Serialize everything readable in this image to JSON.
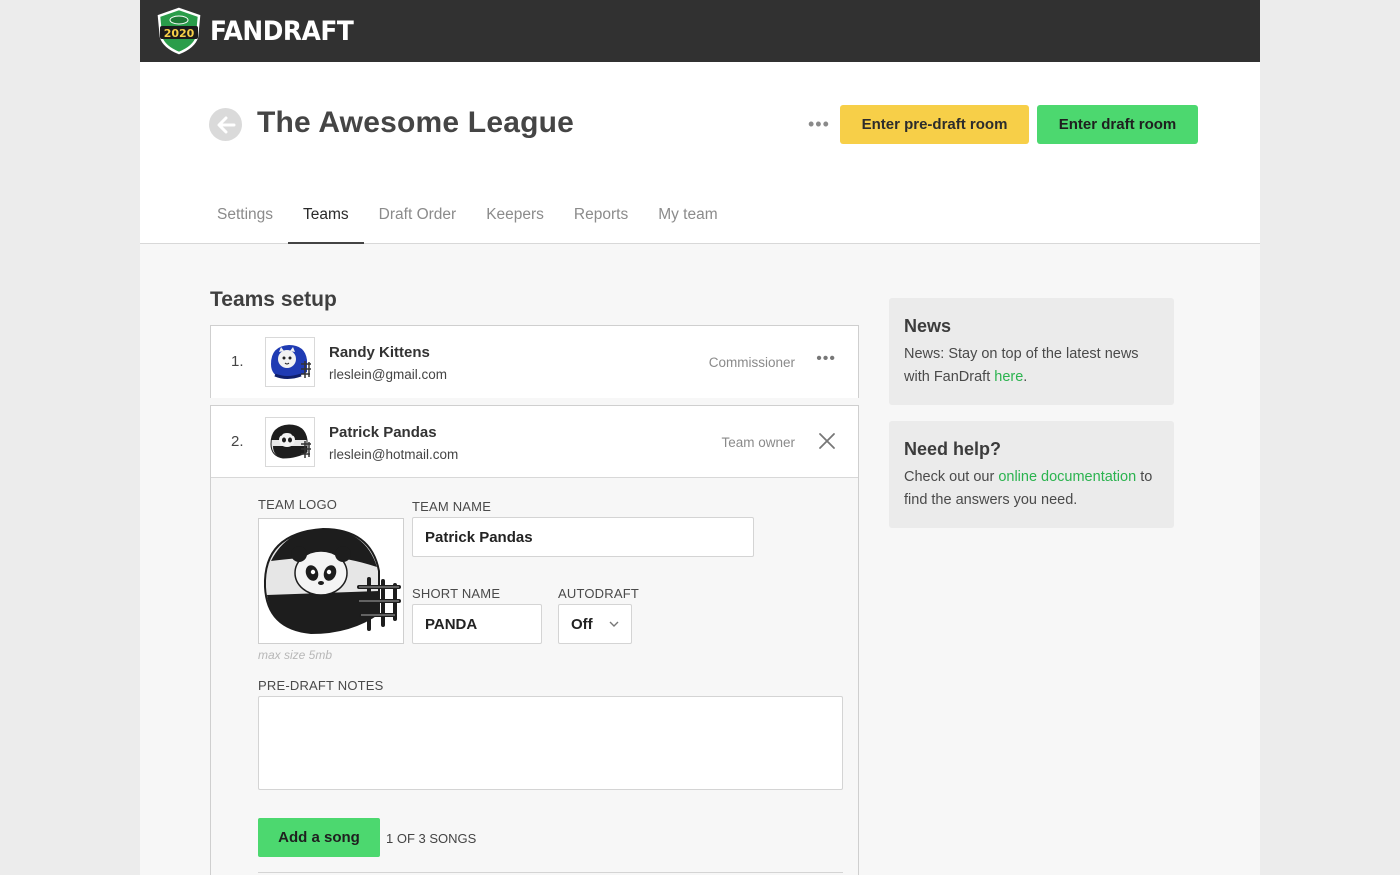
{
  "brand": {
    "name": "FANDRAFT",
    "badge_year": "2020",
    "colors": {
      "topbar": "#313131",
      "shield": "#2a9d4a",
      "accent_green": "#4cd86f",
      "accent_yellow": "#f7cf48",
      "link": "#2bb34f"
    }
  },
  "header": {
    "back_icon": "arrow-left-icon",
    "title": "The Awesome League",
    "more": "•••",
    "pre_draft_button": "Enter pre-draft room",
    "draft_button": "Enter draft room"
  },
  "tabs": [
    {
      "label": "Settings",
      "active": false
    },
    {
      "label": "Teams",
      "active": true
    },
    {
      "label": "Draft Order",
      "active": false
    },
    {
      "label": "Keepers",
      "active": false
    },
    {
      "label": "Reports",
      "active": false
    },
    {
      "label": "My team",
      "active": false
    }
  ],
  "main": {
    "section_title": "Teams setup",
    "teams": [
      {
        "number": "1.",
        "name": "Randy Kittens",
        "email": "rleslein@gmail.com",
        "role": "Commissioner",
        "action": "•••",
        "logo": "kitten-helmet-icon"
      },
      {
        "number": "2.",
        "name": "Patrick Pandas",
        "email": "rleslein@hotmail.com",
        "role": "Team owner",
        "action": "close-icon",
        "logo": "panda-helmet-icon"
      }
    ],
    "edit_form": {
      "team_logo_label": "TEAM LOGO",
      "logo_hint": "max size 5mb",
      "team_name_label": "TEAM NAME",
      "team_name_value": "Patrick Pandas",
      "short_name_label": "SHORT NAME",
      "short_name_value": "PANDA",
      "autodraft_label": "AUTODRAFT",
      "autodraft_value": "Off",
      "notes_label": "PRE-DRAFT NOTES",
      "notes_value": "",
      "add_song_button": "Add a song",
      "song_count": "1 OF 3 SONGS"
    }
  },
  "sidebar": {
    "news": {
      "title": "News",
      "text_before": "News: Stay on top of the latest news with FanDraft ",
      "link": "here",
      "text_after": "."
    },
    "help": {
      "title": "Need help?",
      "text_before": "Check out our ",
      "link": "online documentation",
      "text_after": " to find the answers you need."
    }
  }
}
